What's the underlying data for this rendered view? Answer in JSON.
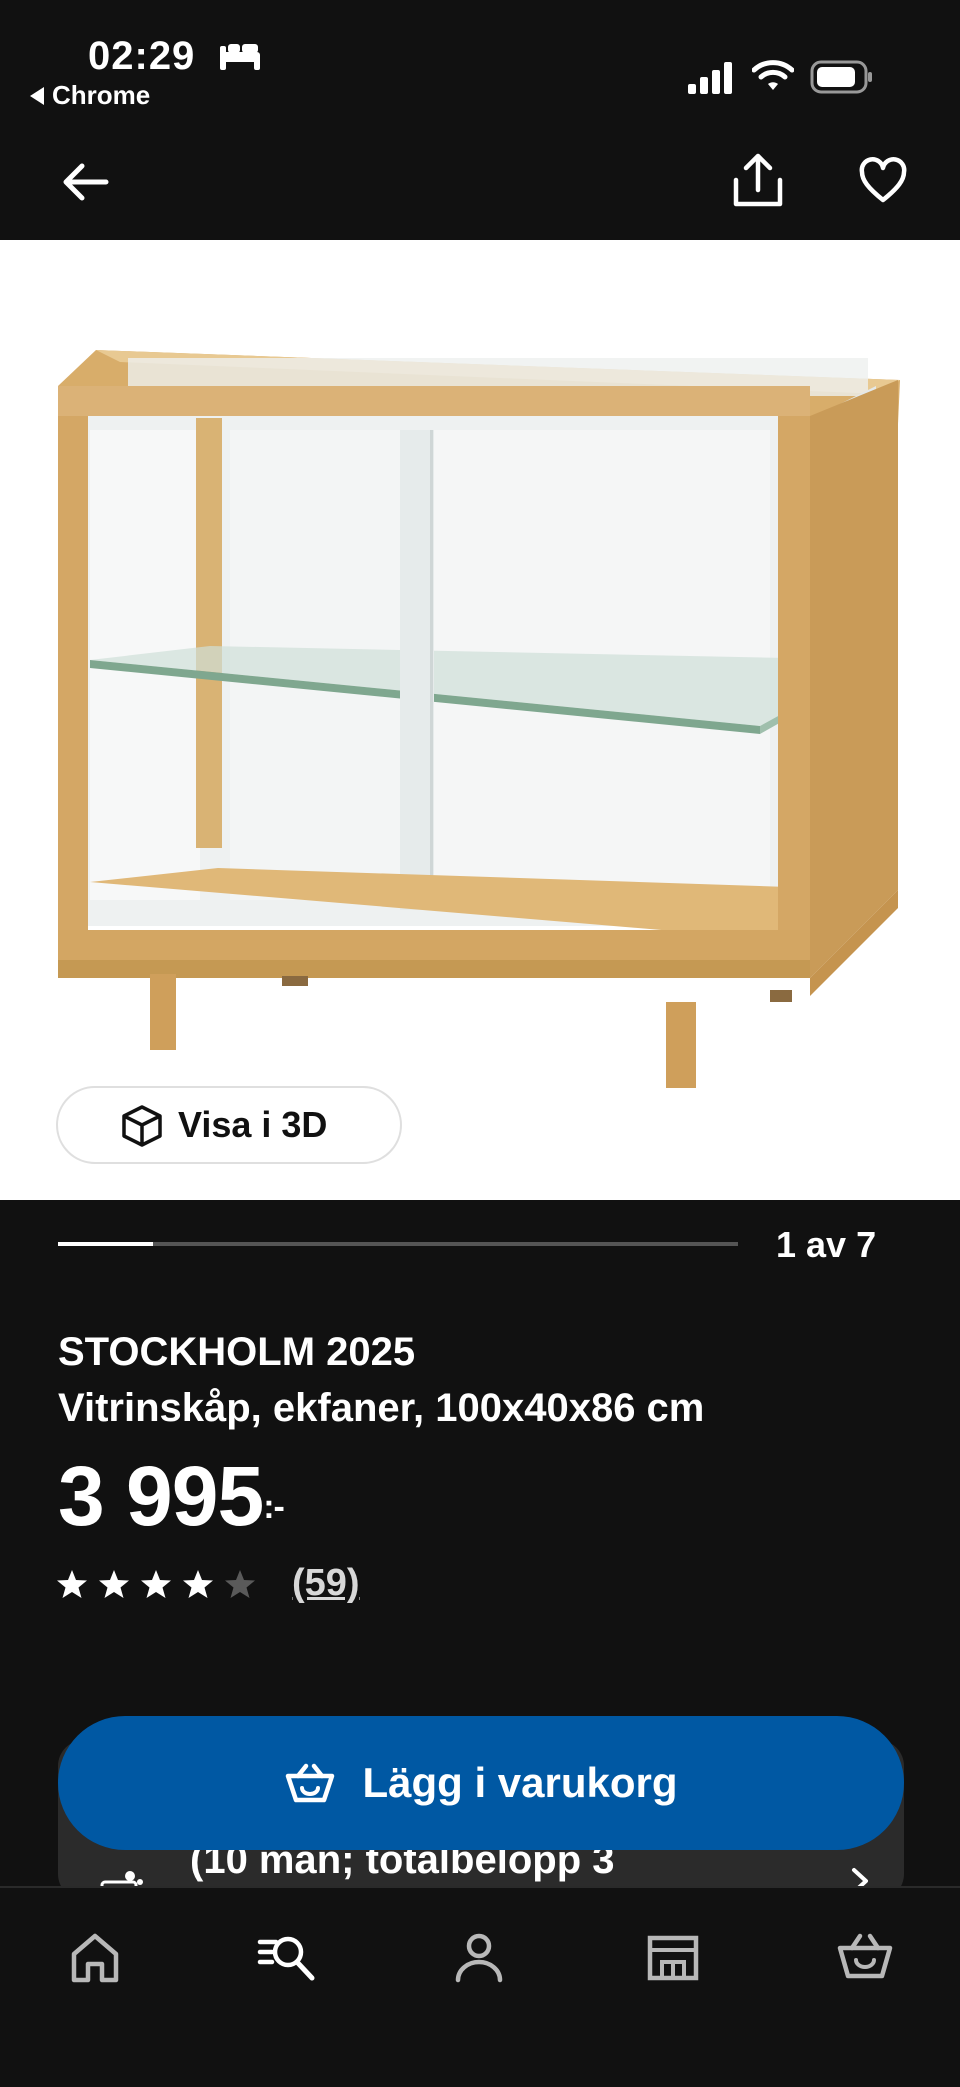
{
  "status_bar": {
    "time": "02:29",
    "back_app_label": "Chrome",
    "icons": [
      "bed-icon",
      "signal-icon",
      "wifi-icon",
      "battery-icon"
    ]
  },
  "nav": {
    "icons": [
      "arrow-left-icon",
      "share-icon",
      "heart-icon"
    ]
  },
  "media": {
    "view_3d_label": "Visa i 3D",
    "page_indicator": "1 av 7",
    "progress": 0.14
  },
  "product": {
    "name": "STOCKHOLM 2025",
    "description": "Vitrinskåp, ekfaner, 100x40x86 cm",
    "price": "3 995",
    "price_suffix": ":-",
    "rating": 4,
    "rating_max": 5,
    "reviews": "(59)"
  },
  "financing": {
    "text": "(10 mån; totalbelopp 3"
  },
  "actions": {
    "add_to_cart_label": "Lägg i varukorg",
    "accent_color": "#0058a3"
  },
  "bottom_nav": {
    "tabs": [
      {
        "icon": "home-icon"
      },
      {
        "icon": "search-list-icon"
      },
      {
        "icon": "person-icon"
      },
      {
        "icon": "store-icon"
      },
      {
        "icon": "basket-icon"
      }
    ]
  }
}
